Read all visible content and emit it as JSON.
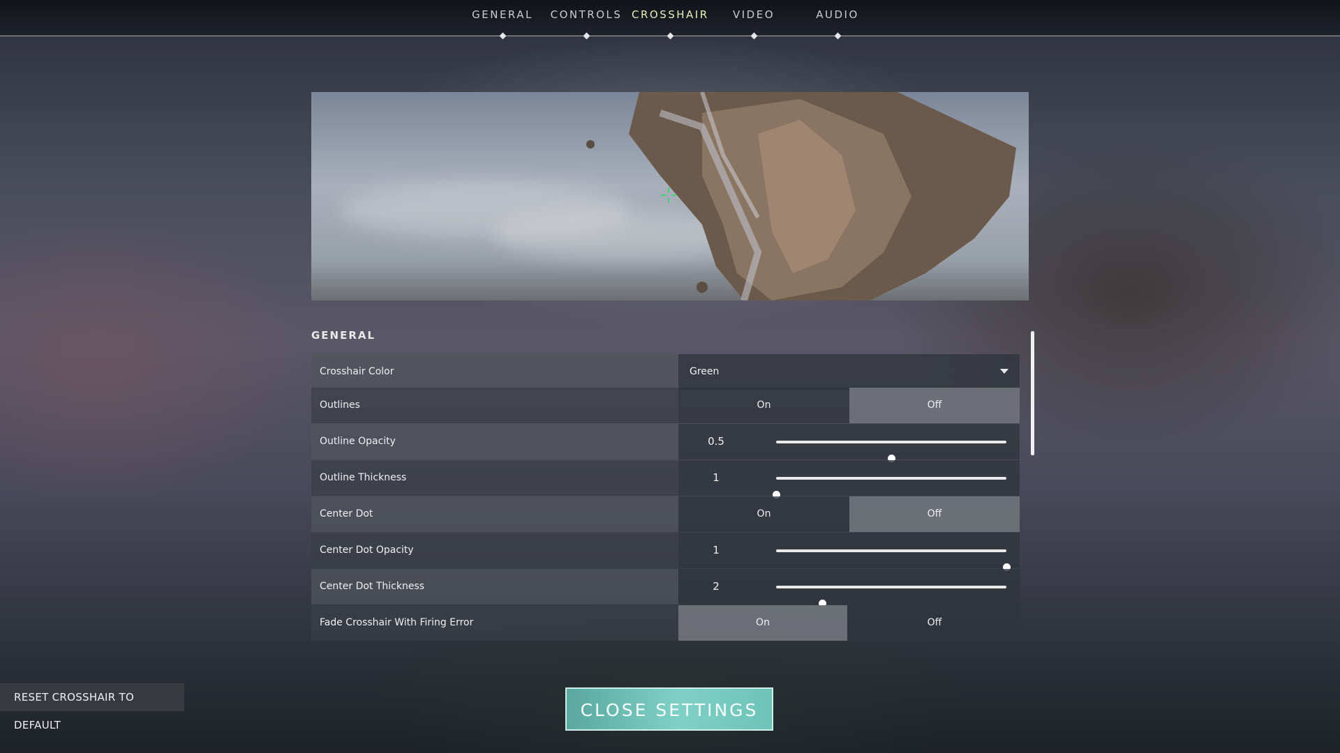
{
  "tabs": [
    {
      "label": "GENERAL"
    },
    {
      "label": "CONTROLS"
    },
    {
      "label": "CROSSHAIR",
      "active": true
    },
    {
      "label": "VIDEO"
    },
    {
      "label": "AUDIO"
    }
  ],
  "section": {
    "title": "GENERAL"
  },
  "settings": {
    "crosshair_color": {
      "label": "Crosshair Color",
      "value": "Green"
    },
    "outlines": {
      "label": "Outlines",
      "on": "On",
      "off": "Off",
      "selected": "Off"
    },
    "outline_opacity": {
      "label": "Outline Opacity",
      "value": "0.5",
      "fraction": 0.5
    },
    "outline_thickness": {
      "label": "Outline Thickness",
      "value": "1",
      "fraction": 0.0
    },
    "center_dot": {
      "label": "Center Dot",
      "on": "On",
      "off": "Off",
      "selected": "Off"
    },
    "center_dot_opacity": {
      "label": "Center Dot Opacity",
      "value": "1",
      "fraction": 1.0
    },
    "center_dot_thickness": {
      "label": "Center Dot Thickness",
      "value": "2",
      "fraction": 0.2
    },
    "fade_crosshair": {
      "label": "Fade Crosshair With Firing Error",
      "on": "On",
      "off": "Off",
      "selected": "On"
    }
  },
  "buttons": {
    "reset": "RESET CROSSHAIR TO DEFAULT",
    "close": "CLOSE SETTINGS"
  },
  "colors": {
    "crosshair": "#3fd36b",
    "accent": "#7fd0c6",
    "active_tab": "#e9efb8"
  }
}
